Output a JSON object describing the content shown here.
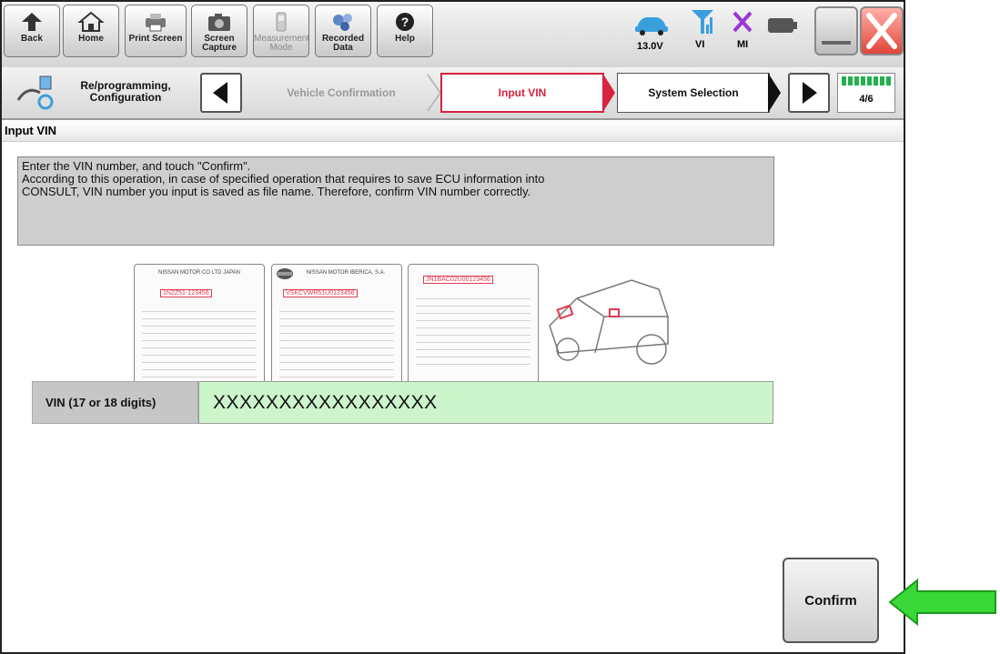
{
  "toolbar": {
    "back": "Back",
    "home": "Home",
    "print_screen": "Print Screen",
    "screen_capture_1": "Screen",
    "screen_capture_2": "Capture",
    "measurement_1": "Measurement",
    "measurement_2": "Mode",
    "recorded_1": "Recorded",
    "recorded_2": "Data",
    "help": "Help"
  },
  "status": {
    "voltage": "13.0V",
    "vi": "VI",
    "mi": "MI"
  },
  "breadcrumb": {
    "function_1": "Re/programming,",
    "function_2": "Configuration",
    "steps": [
      "Vehicle Confirmation",
      "Input VIN",
      "System Selection"
    ],
    "active_step": "Input VIN",
    "progress": "4/6",
    "progress_fraction": 0.667
  },
  "section": {
    "title": "Input VIN"
  },
  "instructions": {
    "line1": "Enter the VIN number, and touch \"Confirm\".",
    "line2": "According to this operation, in case of specified operation that requires to save ECU information into",
    "line3": "CONSULT, VIN number you input is saved as file name. Therefore, confirm VIN number correctly."
  },
  "illustration": {
    "plate1_header": "NISSAN MOTOR CO LTD JAPAN",
    "plate1_vin": "1N2Z51-123456",
    "plate2_header": "NISSAN MOTOR IBERICA, S.A.",
    "plate2_vin": "VSKCVWR51U0123456",
    "plate3_vin": "JN1BAC02U00123456"
  },
  "vin": {
    "label": "VIN (17 or 18 digits)",
    "value": "XXXXXXXXXXXXXXXXX"
  },
  "confirm": {
    "label": "Confirm"
  },
  "colors": {
    "accent_red": "#d8223e",
    "vin_field_bg": "#ccf5cc",
    "progress_green": "#23b14d",
    "callout_arrow": "#37d837"
  }
}
